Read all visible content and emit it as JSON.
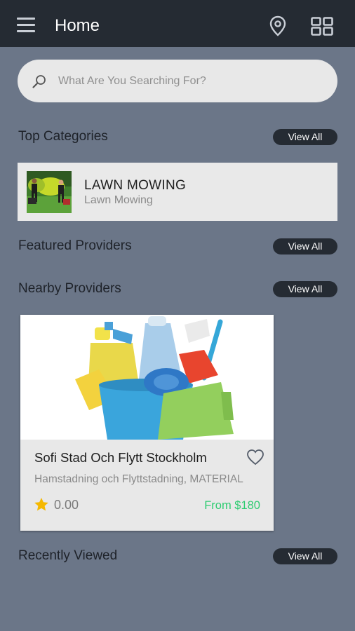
{
  "header": {
    "title": "Home",
    "menu_icon": "menu-icon",
    "location_icon": "map-pin-icon",
    "grid_icon": "grid-view-icon"
  },
  "search": {
    "placeholder": "What Are You Searching For?",
    "value": "",
    "icon": "search-icon"
  },
  "sections": {
    "top_categories": {
      "title": "Top Categories",
      "view_all": "View All"
    },
    "featured_providers": {
      "title": "Featured Providers",
      "view_all": "View All"
    },
    "nearby_providers": {
      "title": "Nearby Providers",
      "view_all": "View All"
    },
    "recently_viewed": {
      "title": "Recently Viewed",
      "view_all": "View All"
    }
  },
  "categories": [
    {
      "name": "LAWN MOWING",
      "subtitle": "Lawn Mowing"
    }
  ],
  "nearby": [
    {
      "name": "Sofi Stad Och Flytt Stockholm",
      "description": "Hamstadning och Flyttstadning, MATERIAL",
      "rating": "0.00",
      "price": "From $180"
    }
  ],
  "colors": {
    "appbar": "#252b33",
    "background": "#6b7688",
    "price": "#2ecc71",
    "star": "#f5b800"
  }
}
